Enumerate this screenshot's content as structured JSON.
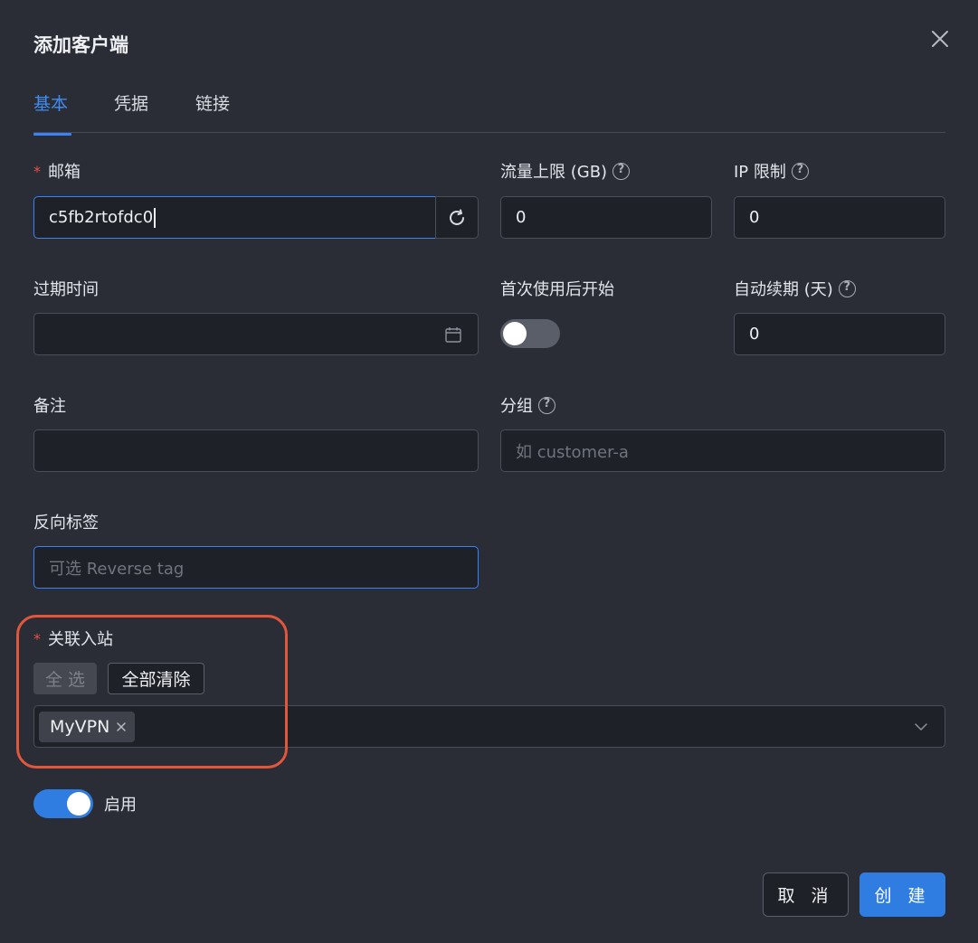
{
  "dialog": {
    "title": "添加客户端"
  },
  "tabs": [
    {
      "label": "基本",
      "active": true
    },
    {
      "label": "凭据",
      "active": false
    },
    {
      "label": "链接",
      "active": false
    }
  ],
  "fields": {
    "email": {
      "label": "邮箱",
      "required": true,
      "value": "c5fb2rtofdc0"
    },
    "traffic_limit": {
      "label": "流量上限 (GB)",
      "value": "0"
    },
    "ip_limit": {
      "label": "IP 限制",
      "value": "0"
    },
    "expiry": {
      "label": "过期时间",
      "value": ""
    },
    "start_after_first_use": {
      "label": "首次使用后开始",
      "enabled": false
    },
    "auto_renew": {
      "label": "自动续期 (天)",
      "value": "0"
    },
    "note": {
      "label": "备注",
      "value": ""
    },
    "group": {
      "label": "分组",
      "placeholder": "如 customer-a"
    },
    "reverse_tag": {
      "label": "反向标签",
      "placeholder": "可选 Reverse tag"
    },
    "inbounds": {
      "label": "关联入站",
      "required": true,
      "select_all_label": "全 选",
      "clear_all_label": "全部清除",
      "selected": [
        "MyVPN"
      ]
    },
    "enable": {
      "label": "启用",
      "enabled": true
    }
  },
  "footer": {
    "cancel_label": "取 消",
    "create_label": "创 建"
  },
  "colors": {
    "accent": "#2f7de1",
    "highlight_ring": "#e0573c",
    "required": "#e5534b"
  },
  "icons": [
    "close-icon",
    "refresh-icon",
    "calendar-icon",
    "help-icon",
    "tag-close-icon",
    "chevron-down-icon"
  ]
}
